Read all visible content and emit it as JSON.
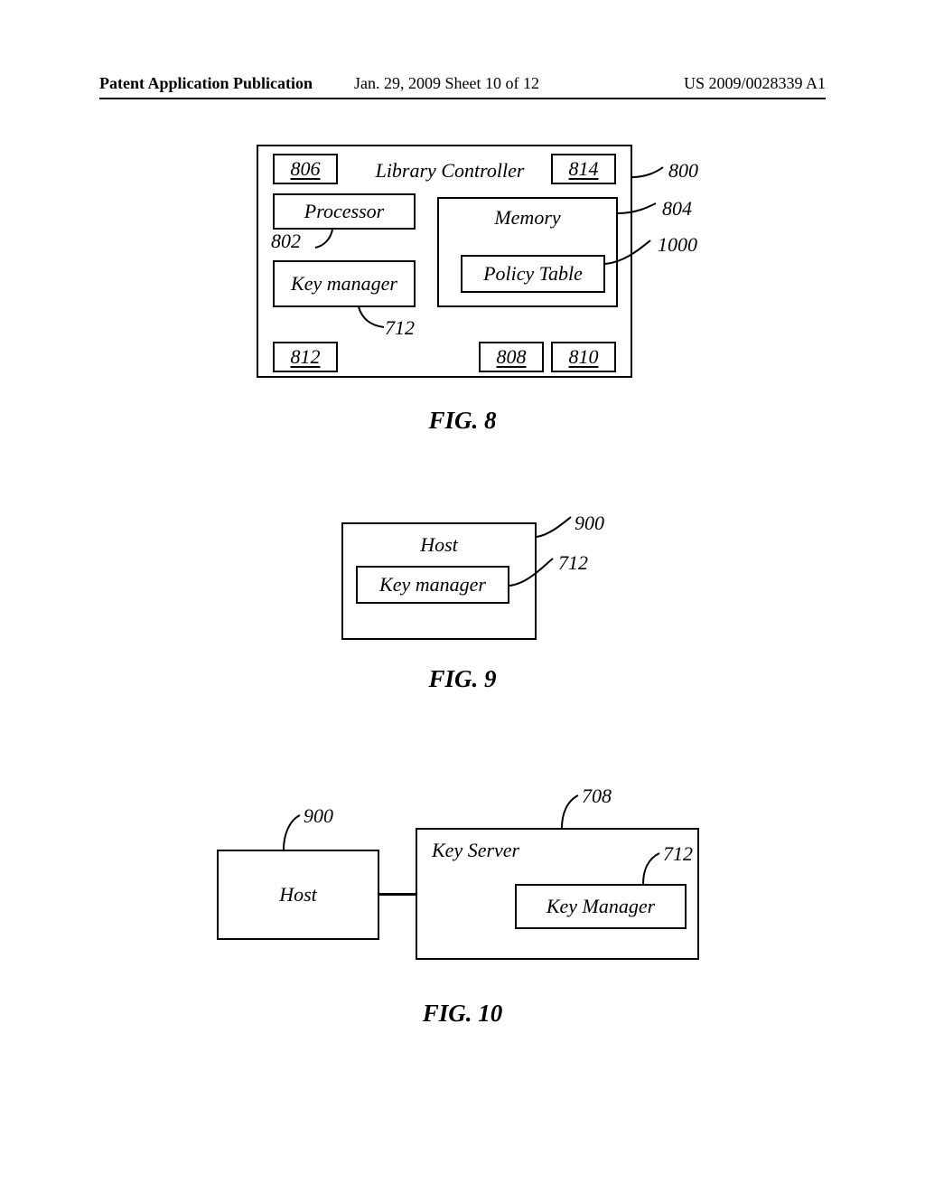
{
  "header": {
    "left": "Patent Application Publication",
    "mid": "Jan. 29, 2009   Sheet 10 of 12",
    "right": "US 2009/0028339 A1"
  },
  "fig8": {
    "title": "Library Controller",
    "processor": "Processor",
    "key_manager": "Key manager",
    "memory": "Memory",
    "policy_table": "Policy Table",
    "n806": "806",
    "n814": "814",
    "n802": "802",
    "n712": "712",
    "n812": "812",
    "n808": "808",
    "n810": "810",
    "lead_800": "800",
    "lead_804": "804",
    "lead_1000": "1000",
    "caption": "FIG. 8"
  },
  "fig9": {
    "host": "Host",
    "key_manager": "Key manager",
    "lead_900": "900",
    "lead_712": "712",
    "caption": "FIG. 9"
  },
  "fig10": {
    "host": "Host",
    "key_server": "Key Server",
    "key_manager": "Key Manager",
    "lead_900": "900",
    "lead_708": "708",
    "lead_712": "712",
    "caption": "FIG. 10"
  }
}
